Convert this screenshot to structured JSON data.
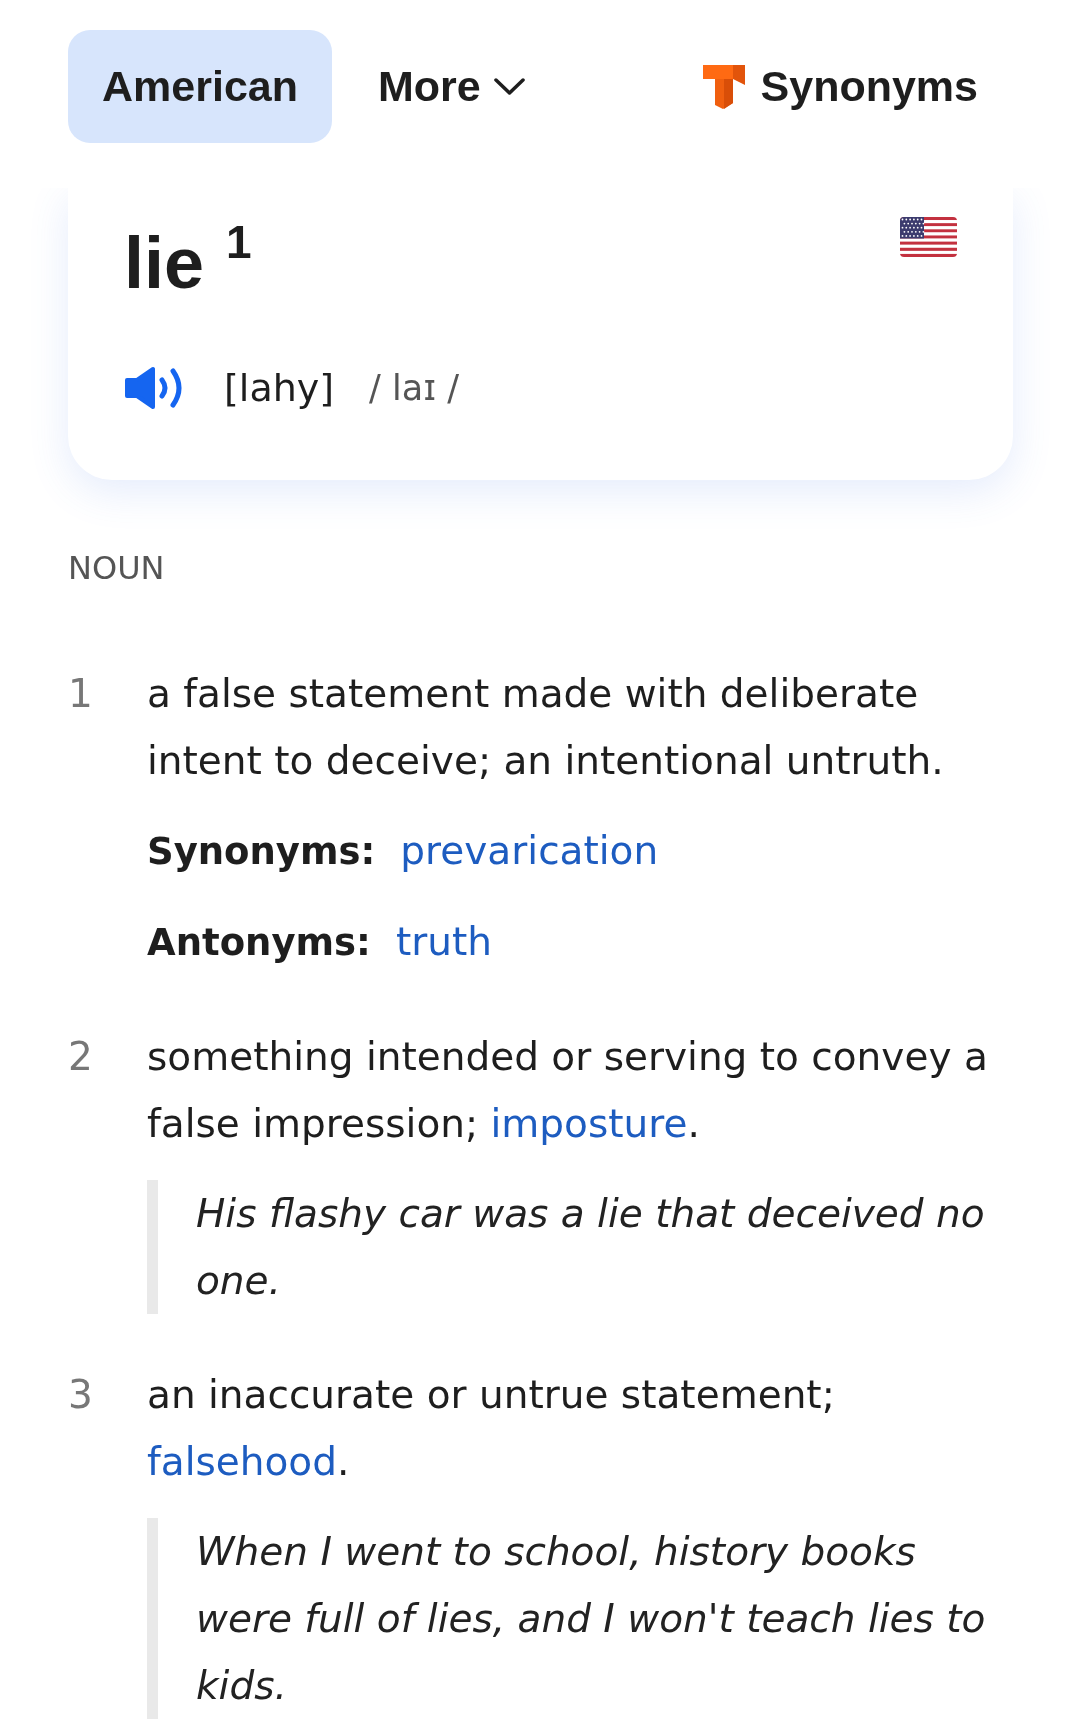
{
  "tabs": [
    {
      "label": "American",
      "selected": true,
      "kind": "tab"
    },
    {
      "label": "More",
      "selected": false,
      "kind": "dropdown"
    }
  ],
  "thesaurus_link": {
    "label": "Synonyms"
  },
  "entry": {
    "headword": "lie",
    "homograph": "1",
    "respelling": "[lahy]",
    "ipa": "/ laɪ /"
  },
  "part_of_speech": "NOUN",
  "definitions": [
    {
      "number": "1",
      "segments": [
        {
          "kind": "plain",
          "text": "a false statement made with deliberate intent to deceive; an intentional untruth."
        }
      ],
      "relations": [
        {
          "label": "Synonyms:",
          "words": [
            "prevarication"
          ]
        },
        {
          "label": "Antonyms:",
          "words": [
            "truth"
          ]
        }
      ]
    },
    {
      "number": "2",
      "segments": [
        {
          "kind": "plain",
          "text": "something intended or serving to convey a false impression; "
        },
        {
          "kind": "link",
          "text": "imposture"
        },
        {
          "kind": "plain",
          "text": "."
        }
      ],
      "example": "His flashy car was a lie that deceived no one."
    },
    {
      "number": "3",
      "segments": [
        {
          "kind": "plain",
          "text": "an inaccurate or untrue statement; "
        },
        {
          "kind": "link",
          "text": "falsehood"
        },
        {
          "kind": "plain",
          "text": "."
        }
      ],
      "example": "When I went to school, history books were full of lies, and I won't teach lies to kids."
    }
  ]
}
